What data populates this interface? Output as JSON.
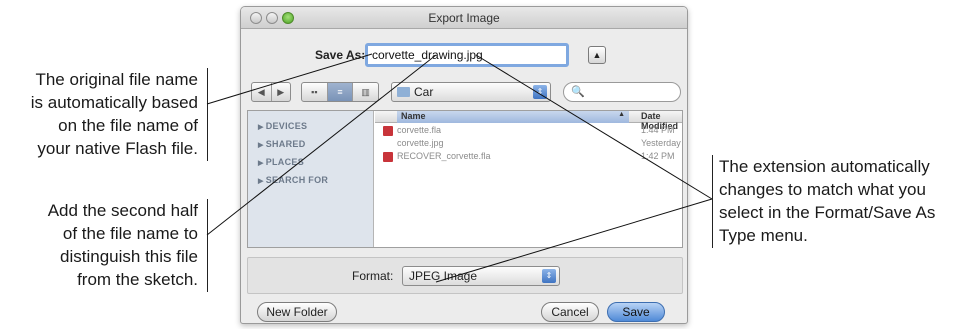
{
  "dialog": {
    "title": "Export Image",
    "save_as_label": "Save As:",
    "save_as_value": "corvette_drawing.jpg",
    "expand_button": "▲",
    "toolbar": {
      "nav": [
        "◀",
        "▶"
      ],
      "view_modes": [
        "▪▪",
        "≡",
        "▥"
      ],
      "location": "Car",
      "search_icon": "🔍"
    },
    "sidebar": [
      "DEVICES",
      "SHARED",
      "PLACES",
      "SEARCH FOR"
    ],
    "columns": {
      "name": "Name",
      "date": "Date Modified"
    },
    "files": [
      {
        "name": "corvette.fla",
        "date": "1:44 PM",
        "icon": "flash-file-icon"
      },
      {
        "name": "corvette.jpg",
        "date": "Yesterday",
        "icon": "image-file-icon"
      },
      {
        "name": "RECOVER_corvette.fla",
        "date": "1:42 PM",
        "icon": "flash-file-icon"
      }
    ],
    "format_label": "Format:",
    "format_value": "JPEG Image",
    "buttons": {
      "new_folder": "New Folder",
      "cancel": "Cancel",
      "save": "Save"
    }
  },
  "callouts": {
    "original_name": [
      "The original file name",
      "is automatically based",
      "on the file name of",
      "your native Flash file."
    ],
    "second_half": [
      "Add the second half",
      "of the file name to",
      "distinguish this file",
      "from the sketch."
    ],
    "extension": [
      "The extension automatically",
      "changes to match what you",
      "select in the Format/Save As",
      "Type menu."
    ]
  }
}
